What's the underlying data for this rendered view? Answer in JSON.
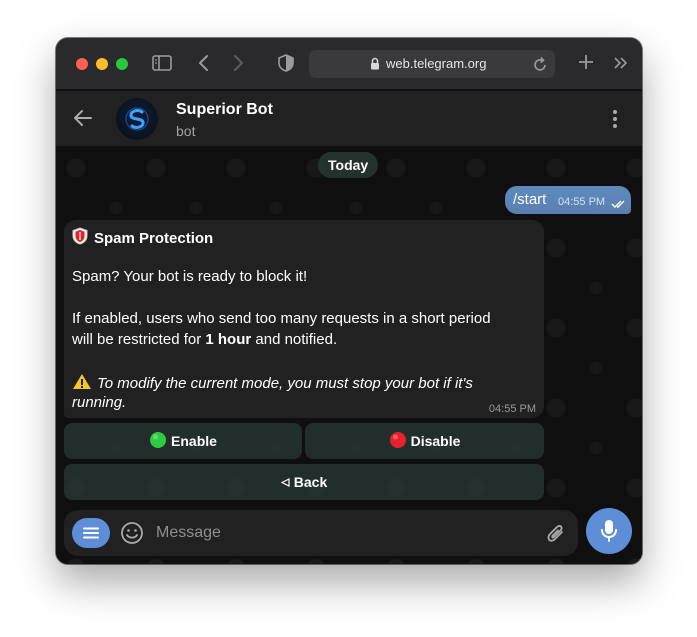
{
  "browser": {
    "url": "web.telegram.org"
  },
  "chat": {
    "title": "Superior Bot",
    "subtitle": "bot",
    "date_label": "Today"
  },
  "messages": {
    "outgoing": {
      "text": "/start",
      "time": "04:55 PM"
    },
    "incoming": {
      "title": "Spam Protection",
      "line1": "Spam? Your bot is ready to block it!",
      "line2": "If enabled, users who send too many requests in a short period",
      "line3_pre": "will be restricted for ",
      "line3_bold": "1 hour",
      "line3_post": " and notified.",
      "warning_line1": "To modify the current mode, you must stop your bot if it's",
      "warning_line2": "running.",
      "time": "04:55 PM"
    }
  },
  "keyboard": {
    "enable": "Enable",
    "disable": "Disable",
    "back": "Back"
  },
  "composer": {
    "placeholder": "Message"
  },
  "colors": {
    "accent": "#5e8ed8",
    "outgoing_bubble": "#5a7fb0",
    "enable_dot": "#2ecc40",
    "disable_dot": "#e8202a"
  }
}
